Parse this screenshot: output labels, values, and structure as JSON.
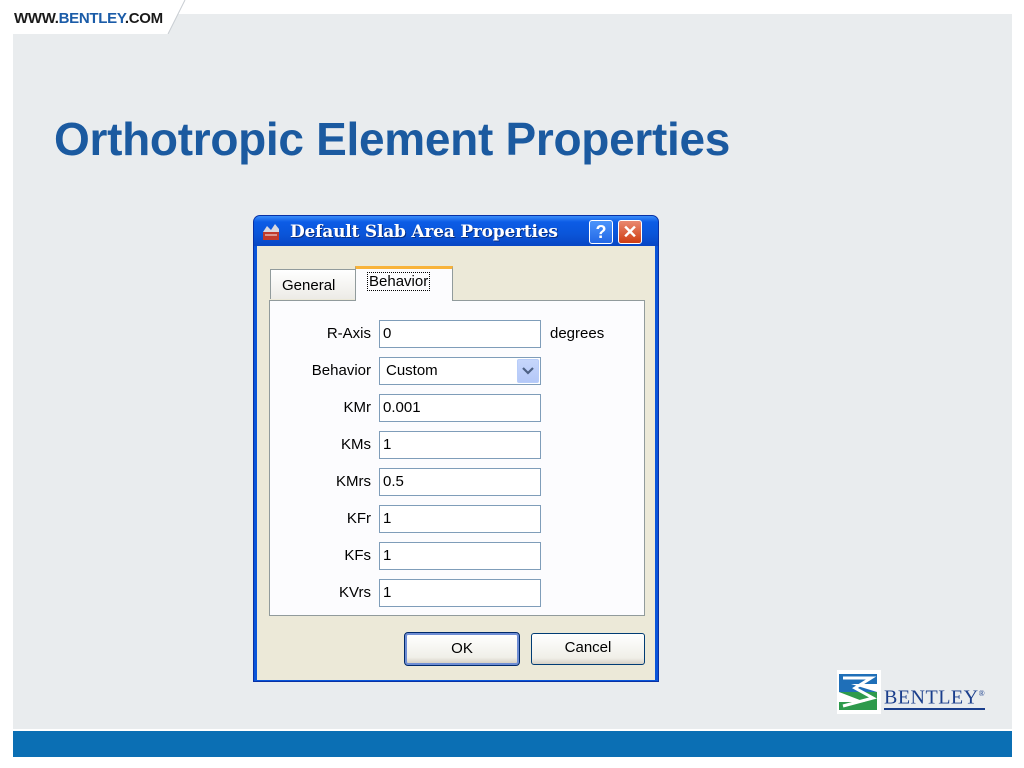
{
  "header": {
    "url_prefix": "WWW.",
    "url_brand": "BENTLEY",
    "url_suffix": ".COM"
  },
  "slide": {
    "title": "Orthotropic Element Properties"
  },
  "dialog": {
    "title": "Default Slab Area Properties",
    "help_label": "?",
    "close_label": "✕",
    "tabs": [
      {
        "label": "General",
        "active": false
      },
      {
        "label": "Behavior",
        "active": true
      }
    ],
    "fields": {
      "r_axis": {
        "label": "R-Axis",
        "value": "0",
        "unit": "degrees"
      },
      "behavior": {
        "label": "Behavior",
        "value": "Custom"
      },
      "kmr": {
        "label": "KMr",
        "value": "0.001"
      },
      "kms": {
        "label": "KMs",
        "value": "1"
      },
      "kmrs": {
        "label": "KMrs",
        "value": "0.5"
      },
      "kfr": {
        "label": "KFr",
        "value": "1"
      },
      "kfs": {
        "label": "KFs",
        "value": "1"
      },
      "kvrs": {
        "label": "KVrs",
        "value": "1"
      }
    },
    "ok_label": "OK",
    "cancel_label": "Cancel"
  },
  "logo": {
    "text": "BENTLEY",
    "mark": "®",
    "icon": "bentley-b-logo-icon"
  },
  "colors": {
    "title_blue": "#1b5aa0",
    "footer_blue": "#0b6fb4",
    "xp_titlebar": "#0a55d9"
  }
}
